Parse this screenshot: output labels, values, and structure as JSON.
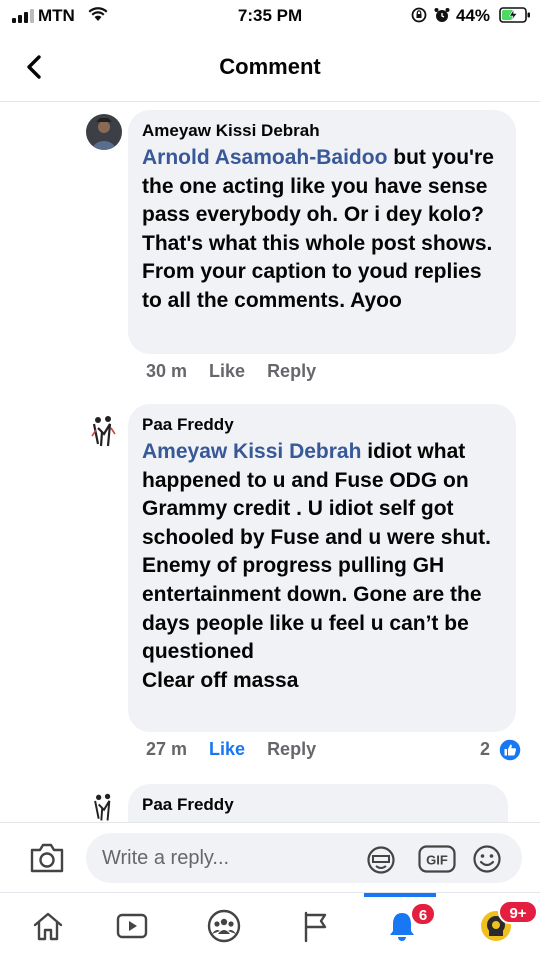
{
  "status_bar": {
    "carrier": "MTN",
    "time": "7:35 PM",
    "battery_percent": "44%",
    "signal_bars": 3
  },
  "header": {
    "title": "Comment",
    "back_icon": "chevron-left-icon"
  },
  "comments": [
    {
      "author": "Ameyaw Kissi Debrah",
      "mention": "Arnold Asamoah-Baidoo",
      "text": " but you're the one acting like you have sense pass everybody oh. Or i dey kolo? That's what this whole post shows. From your caption to youd replies to all the comments.  Ayoo",
      "time": "30 m",
      "like_label": "Like",
      "reply_label": "Reply",
      "liked": false
    },
    {
      "author": "Paa Freddy",
      "mention": "Ameyaw Kissi Debrah",
      "text": " idiot what happened to u and Fuse ODG on Grammy credit . U idiot self got schooled by Fuse and u were shut.\nEnemy of progress pulling GH entertainment down. Gone are the days people like u feel u can’t be questioned\nClear off massa",
      "time": "27 m",
      "like_label": "Like",
      "reply_label": "Reply",
      "liked": true,
      "reaction_count": "2"
    },
    {
      "author": "Paa Freddy"
    }
  ],
  "composer": {
    "placeholder": "Write a reply...",
    "gif_label": "GIF"
  },
  "tabbar": {
    "tabs": [
      "home-icon",
      "watch-icon",
      "groups-icon",
      "pages-icon",
      "notifications-icon",
      "menu-icon"
    ],
    "active": "notifications-icon",
    "notifications_badge": "6",
    "menu_badge": "9+"
  },
  "colors": {
    "accent": "#1877f2",
    "mention": "#385898",
    "bubble": "#f0f2f5",
    "badge": "#e41e3f",
    "meta": "#65676b"
  }
}
